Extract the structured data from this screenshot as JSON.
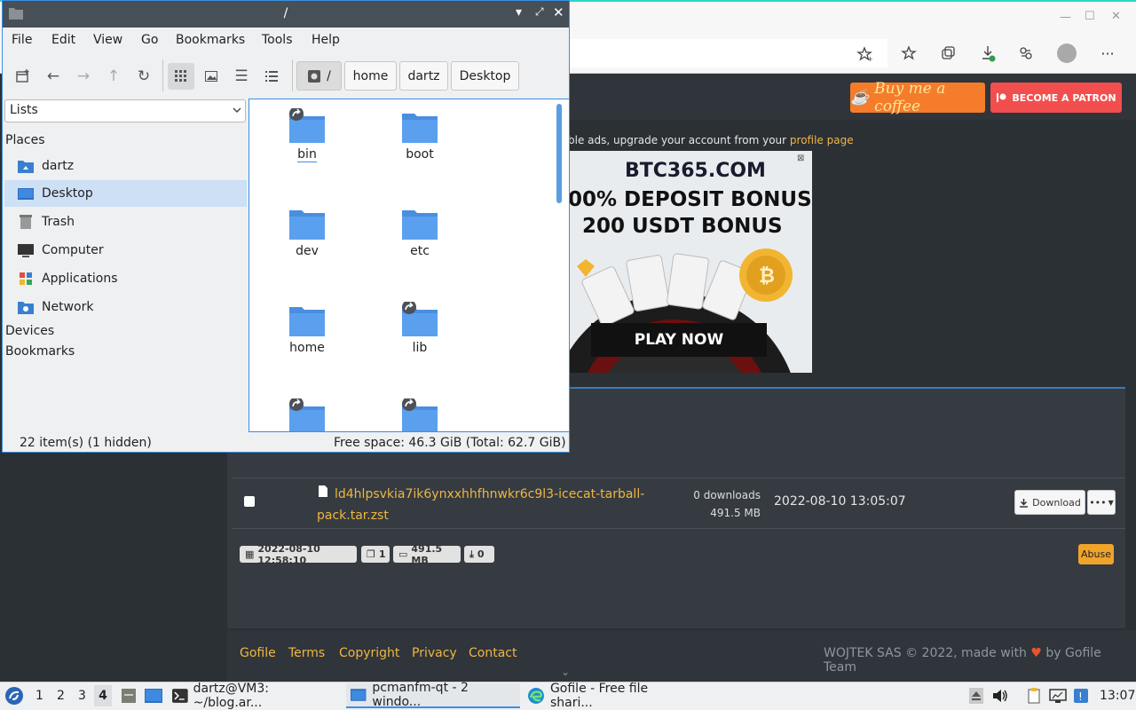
{
  "browser": {
    "support": {
      "coffee_label": "Buy me a coffee",
      "patron_label": "BECOME A PATRON"
    },
    "ads_note_text": "ble ads, upgrade your account from your ",
    "ads_note_link": "profile page",
    "ad": {
      "logo": "BTC365.COM",
      "headline1": "00% DEPOSIT BONUS",
      "headline2": "200 USDT BONUS",
      "cta": "PLAY NOW"
    },
    "file": {
      "name": "ld4hlpsvkia7ik6ynxxhhfhnwkr6c9l3-icecat-tarball-pack.tar.zst",
      "downloads": "0 downloads",
      "size": "491.5 MB",
      "date": "2022-08-10 13:05:07",
      "download_label": "Download",
      "more_label": "•••"
    },
    "badges": {
      "created": "2022-08-10 12:58:10",
      "files": "1",
      "total_size": "491.5 MB",
      "download_count": "0"
    },
    "abuse_label": "Abuse",
    "footer": {
      "links": [
        "Gofile",
        "Terms",
        "Copyright",
        "Privacy",
        "Contact"
      ],
      "copyright_left": "WOJTEK SAS © 2022, made with",
      "copyright_right": "by Gofile Team"
    }
  },
  "file_manager": {
    "title": "/",
    "menu": [
      "File",
      "Edit",
      "View",
      "Go",
      "Bookmarks",
      "Tools",
      "Help"
    ],
    "path": {
      "root": "/",
      "crumbs": [
        "home",
        "dartz",
        "Desktop"
      ]
    },
    "side_pane_mode": "Lists",
    "sections": {
      "places": "Places",
      "devices": "Devices",
      "bookmarks": "Bookmarks"
    },
    "places": [
      {
        "label": "dartz",
        "icon": "home-folder-icon"
      },
      {
        "label": "Desktop",
        "icon": "desktop-icon",
        "selected": true
      },
      {
        "label": "Trash",
        "icon": "trash-icon"
      },
      {
        "label": "Computer",
        "icon": "computer-icon"
      },
      {
        "label": "Applications",
        "icon": "applications-icon"
      },
      {
        "label": "Network",
        "icon": "network-icon"
      }
    ],
    "files": [
      {
        "name": "bin",
        "symlink": true
      },
      {
        "name": "boot",
        "symlink": false
      },
      {
        "name": "dev",
        "symlink": false
      },
      {
        "name": "etc",
        "symlink": false
      },
      {
        "name": "home",
        "symlink": false
      },
      {
        "name": "lib",
        "symlink": true
      },
      {
        "name": "",
        "symlink": true
      },
      {
        "name": "",
        "symlink": true
      }
    ],
    "status_left": "22 item(s) (1 hidden)",
    "status_right": "Free space: 46.3 GiB (Total: 62.7 GiB)"
  },
  "taskbar": {
    "workspaces": [
      "1",
      "2",
      "3",
      "4"
    ],
    "active_workspace": "4",
    "tasks": [
      {
        "label": "dartz@VM3: ~/blog.ar...",
        "icon": "terminal-icon"
      },
      {
        "label": "pcmanfm-qt - 2 windo...",
        "icon": "folder-icon",
        "active": true
      },
      {
        "label": "Gofile - Free file shari...",
        "icon": "edge-icon"
      }
    ],
    "clock": "13:07"
  }
}
